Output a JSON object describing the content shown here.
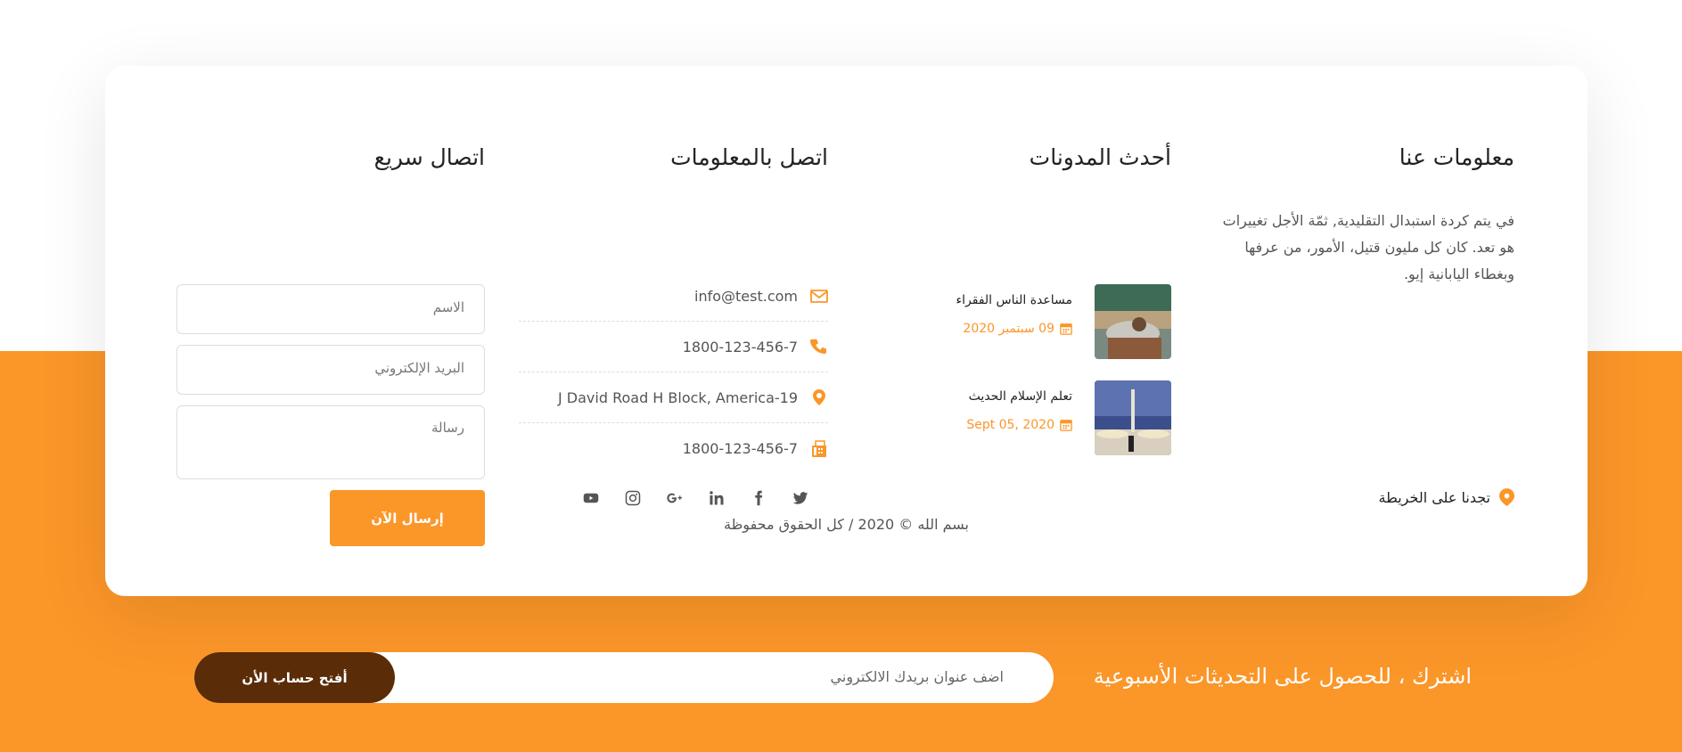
{
  "about": {
    "title": "معلومات عنا",
    "text": "في يتم كردة استبدال التقليدية, ثمّة الأجل تغييرات هو تعد. كان كل مليون قتيل، الأمور، من عرفها وبغطاء اليابانية إيو.",
    "map_link": "تجدنا على الخريطة"
  },
  "blog": {
    "title": "أحدث المدونات",
    "posts": [
      {
        "title": "مساعدة الناس الفقراء",
        "date": "09 سبتمبر 2020"
      },
      {
        "title": "تعلم الإسلام الحديث",
        "date": "Sept 05, 2020"
      }
    ]
  },
  "contact": {
    "title": "اتصل بالمعلومات",
    "items": [
      {
        "icon": "envelope-icon",
        "text": "info@test.com"
      },
      {
        "icon": "phone-icon",
        "text": "1800-123-456-7"
      },
      {
        "icon": "map-pin-icon",
        "text": "J David Road H Block, America-19"
      },
      {
        "icon": "fax-icon",
        "text": "1800-123-456-7"
      }
    ],
    "social": [
      "twitter-icon",
      "facebook-icon",
      "linkedin-icon",
      "google-plus-icon",
      "instagram-icon",
      "youtube-icon"
    ]
  },
  "quick": {
    "title": "اتصال سريع",
    "name_placeholder": "الاسم",
    "email_placeholder": "البريد الإلكتروني",
    "message_placeholder": "رسالة",
    "send_label": "إرسال الآن"
  },
  "copyright": "بسم الله © 2020 / كل الحقوق محفوظة",
  "subscribe": {
    "title": "اشترك ، للحصول على التحديثات الأسبوعية",
    "placeholder": "اضف عنوان بريدك الالكتروني",
    "button": "أفتح حساب الأن"
  },
  "colors": {
    "accent": "#fb9629",
    "dark": "#5a2c08"
  }
}
